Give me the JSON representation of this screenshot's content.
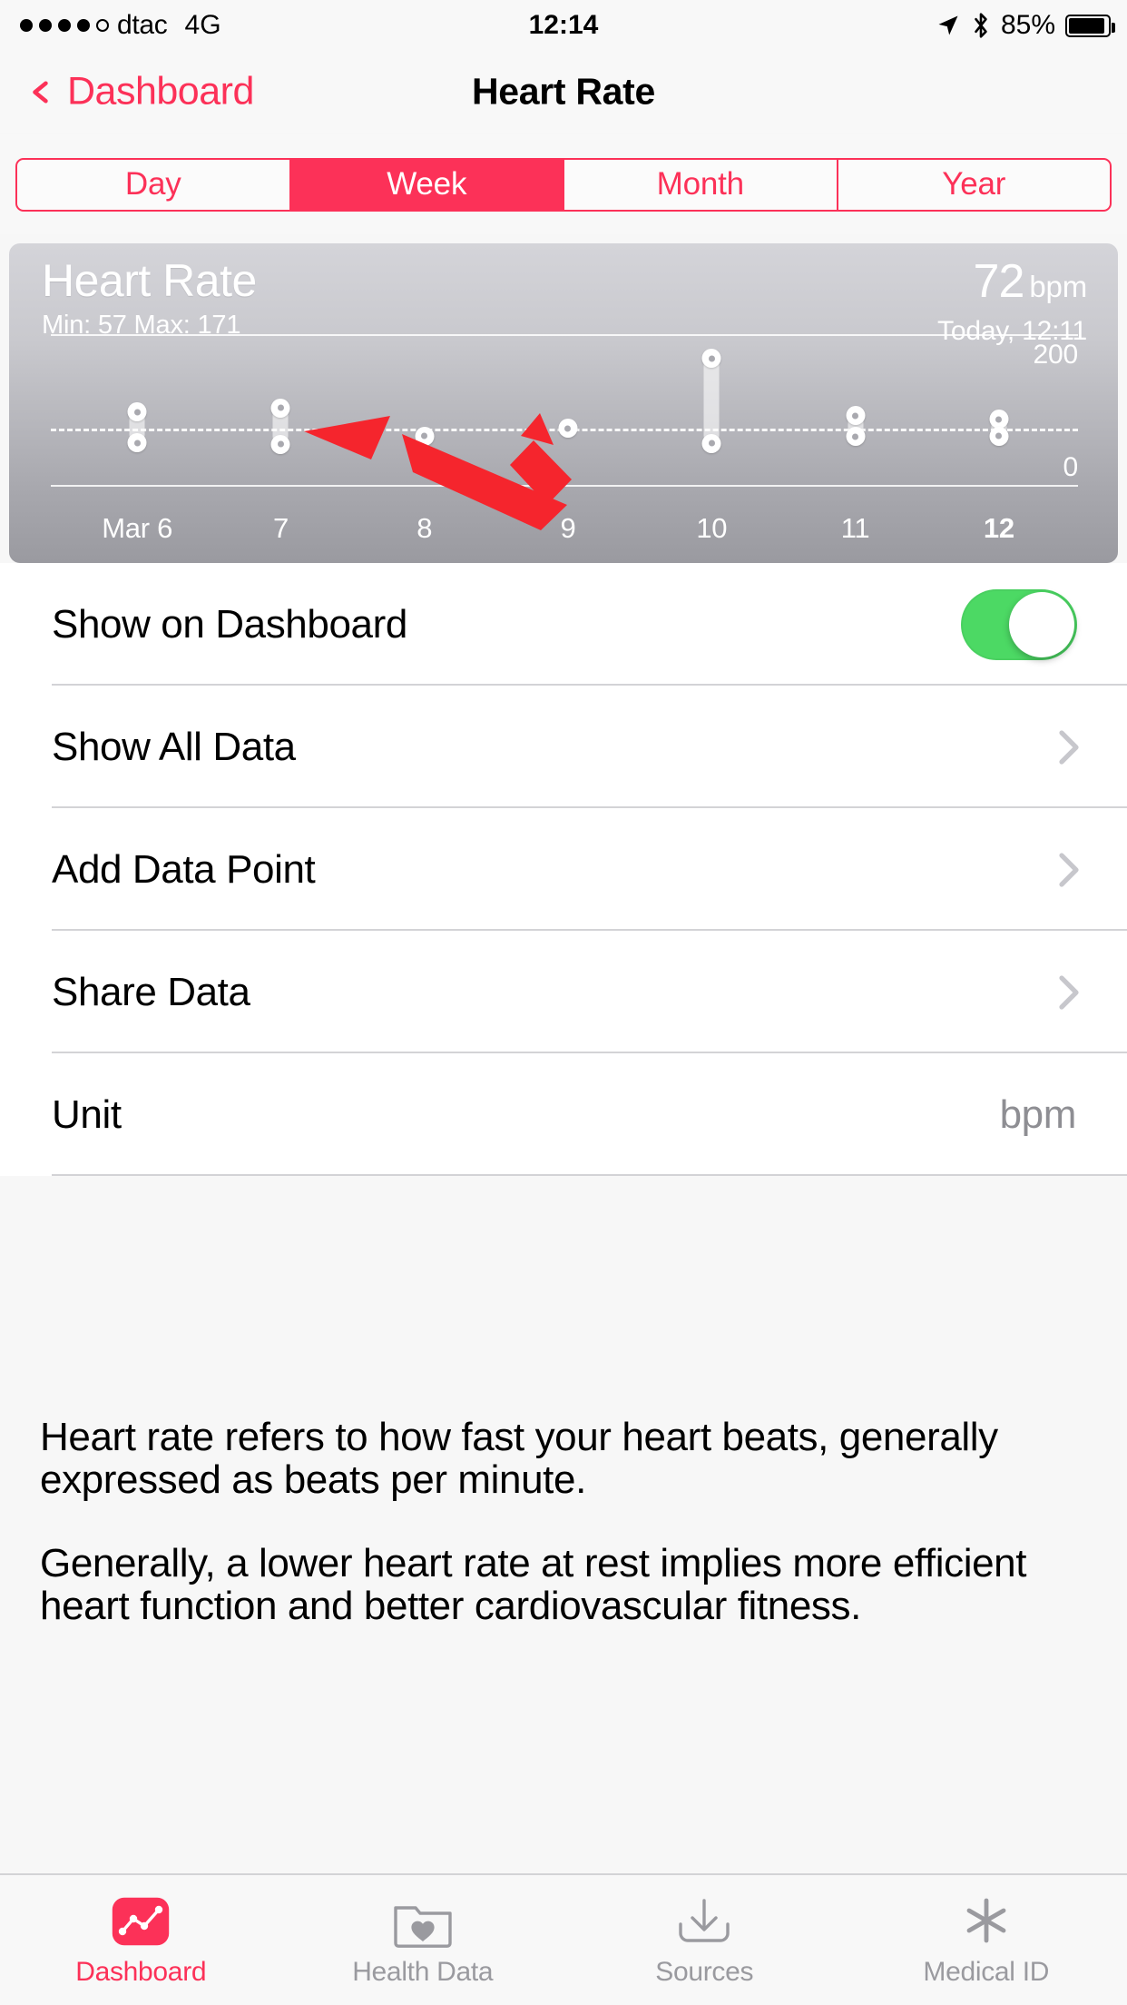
{
  "status_bar": {
    "signal_dots": [
      true,
      true,
      true,
      true,
      false
    ],
    "carrier": "dtac",
    "network": "4G",
    "time": "12:14",
    "battery_percent": "85%",
    "battery_level": 85,
    "location_icon": "location-arrow-icon",
    "bluetooth_icon": "bluetooth-icon"
  },
  "nav": {
    "back_label": "Dashboard",
    "title": "Heart Rate"
  },
  "segmented": {
    "options": [
      "Day",
      "Week",
      "Month",
      "Year"
    ],
    "selected": "Week",
    "accent_color": "#fc3158"
  },
  "chart_card": {
    "title": "Heart Rate",
    "minmax": "Min: 57  Max: 171",
    "min": 57,
    "max": 171,
    "current_value": "72",
    "current_unit": "bpm",
    "timestamp": "Today, 12:11"
  },
  "chart_data": {
    "type": "bar",
    "title": "Heart Rate",
    "xlabel": "",
    "ylabel": "bpm",
    "ylim": [
      0,
      200
    ],
    "axis_tick_labels": [
      "200",
      "0"
    ],
    "grid": false,
    "average_line": 77,
    "average_line_style": "dashed",
    "categories": [
      "Mar 6",
      "7",
      "8",
      "9",
      "10",
      "11",
      "12"
    ],
    "today_index": 6,
    "series": [
      {
        "name": "min",
        "values": [
          59,
          57,
          67,
          77,
          58,
          67,
          68
        ]
      },
      {
        "name": "max",
        "values": [
          100,
          105,
          69,
          79,
          171,
          95,
          90
        ]
      }
    ],
    "bars": [
      {
        "label": "Mar 6",
        "low": 59,
        "high": 100
      },
      {
        "label": "7",
        "low": 57,
        "high": 105
      },
      {
        "label": "8",
        "low": 67,
        "high": 69
      },
      {
        "label": "9",
        "low": 77,
        "high": 79
      },
      {
        "label": "10",
        "low": 58,
        "high": 171
      },
      {
        "label": "11",
        "low": 67,
        "high": 95
      },
      {
        "label": "12",
        "low": 68,
        "high": 90
      }
    ]
  },
  "annotations": {
    "arrow_color": "#f5252d",
    "arrow_count": 2,
    "description": "two red arrows pointing at the Mar 8 and Mar 9 data points"
  },
  "list": {
    "rows": [
      {
        "label": "Show on Dashboard",
        "control": "toggle",
        "value": "on"
      },
      {
        "label": "Show All Data",
        "control": "chevron",
        "value": ""
      },
      {
        "label": "Add Data Point",
        "control": "chevron",
        "value": ""
      },
      {
        "label": "Share Data",
        "control": "chevron",
        "value": ""
      },
      {
        "label": "Unit",
        "control": "value",
        "value": "bpm"
      }
    ]
  },
  "description": {
    "paragraphs": [
      "Heart rate refers to how fast your heart beats, generally expressed as beats per minute.",
      "Generally, a lower heart rate at rest implies more efficient heart function and better cardiovascular fitness."
    ]
  },
  "tabbar": {
    "items": [
      {
        "label": "Dashboard",
        "icon": "dashboard-chart-icon",
        "active": true
      },
      {
        "label": "Health Data",
        "icon": "health-data-folder-icon",
        "active": false
      },
      {
        "label": "Sources",
        "icon": "sources-download-icon",
        "active": false
      },
      {
        "label": "Medical ID",
        "icon": "medical-id-asterisk-icon",
        "active": false
      }
    ]
  }
}
